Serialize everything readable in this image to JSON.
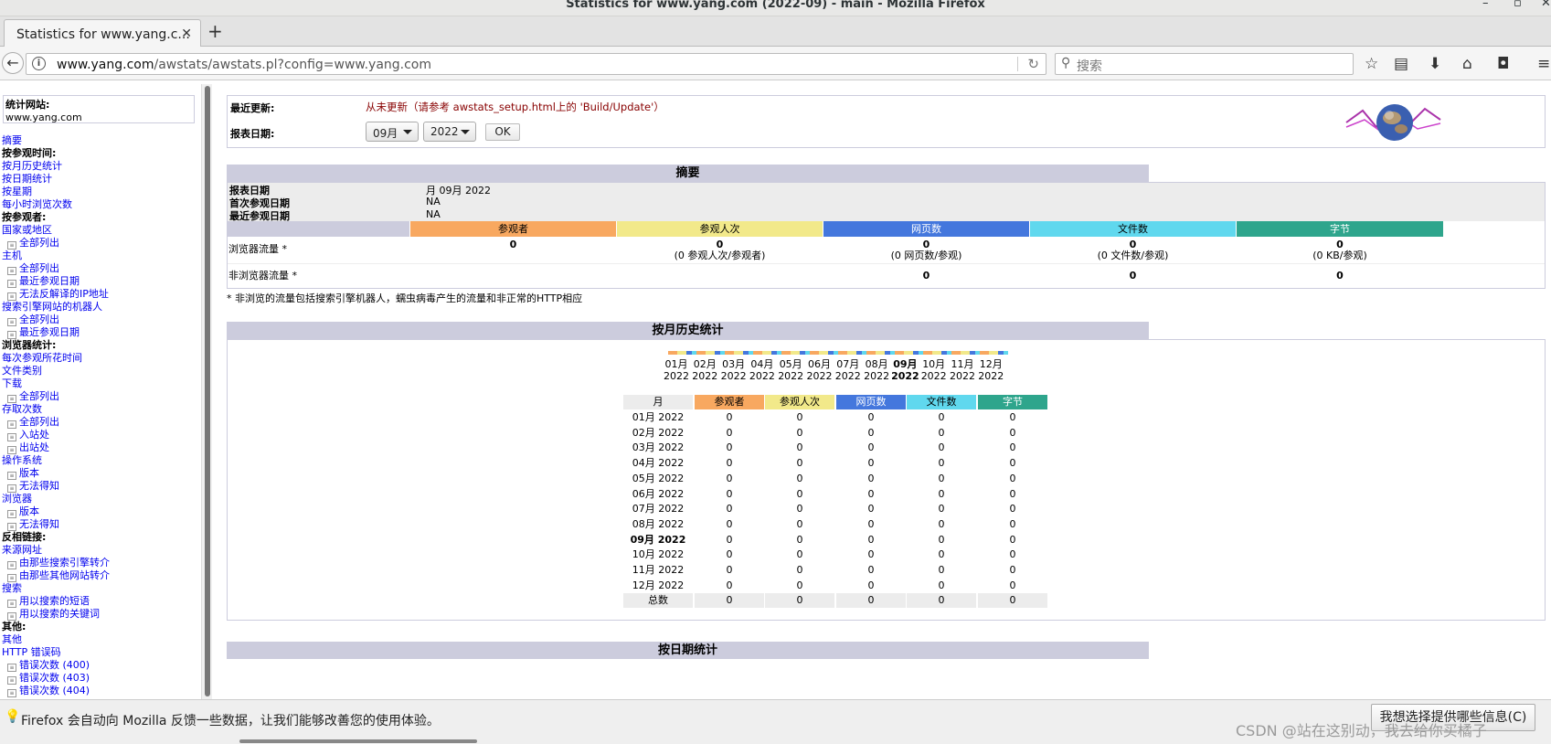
{
  "window": {
    "title": "Statistics for www.yang.com (2022-09) - main - Mozilla Firefox"
  },
  "tab": {
    "title": "Statistics for www.yang.c..."
  },
  "navbar": {
    "url_domain": "www.yang.com",
    "url_path": "/awstats/awstats.pl?config=www.yang.com",
    "search_placeholder": "搜索"
  },
  "sidebar": {
    "site_label": "统计网站:",
    "site_value": "www.yang.com",
    "items": [
      {
        "text": "摘要",
        "type": "lnk"
      },
      {
        "text": "按参观时间:",
        "type": "sec"
      },
      {
        "text": "按月历史统计",
        "type": "lnk"
      },
      {
        "text": "按日期统计",
        "type": "lnk"
      },
      {
        "text": "按星期",
        "type": "lnk"
      },
      {
        "text": "每小时浏览次数",
        "type": "lnk"
      },
      {
        "text": "按参观者:",
        "type": "sec"
      },
      {
        "text": "国家或地区",
        "type": "lnk"
      },
      {
        "text": "全部列出",
        "type": "sub"
      },
      {
        "text": "主机",
        "type": "lnk"
      },
      {
        "text": "全部列出",
        "type": "sub"
      },
      {
        "text": "最近参观日期",
        "type": "sub"
      },
      {
        "text": "无法反解译的IP地址",
        "type": "sub"
      },
      {
        "text": "搜索引擎网站的机器人",
        "type": "lnk"
      },
      {
        "text": "全部列出",
        "type": "sub"
      },
      {
        "text": "最近参观日期",
        "type": "sub"
      },
      {
        "text": "浏览器统计:",
        "type": "sec"
      },
      {
        "text": "每次参观所花时间",
        "type": "lnk"
      },
      {
        "text": "文件类别",
        "type": "lnk"
      },
      {
        "text": "下载",
        "type": "lnk"
      },
      {
        "text": "全部列出",
        "type": "sub"
      },
      {
        "text": "存取次数",
        "type": "lnk"
      },
      {
        "text": "全部列出",
        "type": "sub"
      },
      {
        "text": "入站处",
        "type": "sub"
      },
      {
        "text": "出站处",
        "type": "sub"
      },
      {
        "text": "操作系统",
        "type": "lnk"
      },
      {
        "text": "版本",
        "type": "sub"
      },
      {
        "text": "无法得知",
        "type": "sub"
      },
      {
        "text": "浏览器",
        "type": "lnk"
      },
      {
        "text": "版本",
        "type": "sub"
      },
      {
        "text": "无法得知",
        "type": "sub"
      },
      {
        "text": "反相链接:",
        "type": "sec"
      },
      {
        "text": "来源网址",
        "type": "lnk"
      },
      {
        "text": "由那些搜索引擎转介",
        "type": "sub"
      },
      {
        "text": "由那些其他网站转介",
        "type": "sub"
      },
      {
        "text": "搜索",
        "type": "lnk"
      },
      {
        "text": "用以搜索的短语",
        "type": "sub"
      },
      {
        "text": "用以搜索的关键词",
        "type": "sub"
      },
      {
        "text": "其他:",
        "type": "sec"
      },
      {
        "text": "其他",
        "type": "lnk"
      },
      {
        "text": "HTTP 错误码",
        "type": "lnk"
      },
      {
        "text": "错误次数 (400)",
        "type": "sub"
      },
      {
        "text": "错误次数 (403)",
        "type": "sub"
      },
      {
        "text": "错误次数 (404)",
        "type": "sub"
      }
    ]
  },
  "header": {
    "last_update_label": "最近更新:",
    "last_update_value": "从未更新（请参考 awstats_setup.html上的 'Build/Update'）",
    "report_date_label": "报表日期:",
    "month_select": "09月",
    "year_select": "2022",
    "ok_button": "OK"
  },
  "summary": {
    "title": "摘要",
    "rows": [
      {
        "k": "报表日期",
        "v": "月 09月 2022"
      },
      {
        "k": "首次参观日期",
        "v": "NA"
      },
      {
        "k": "最近参观日期",
        "v": "NA"
      }
    ],
    "cols": [
      "参观者",
      "参观人次",
      "网页数",
      "文件数",
      "字节"
    ],
    "browser_label": "浏览器流量 *",
    "browser_vals": [
      "0",
      "0",
      "0",
      "0",
      "0"
    ],
    "browser_subs": [
      "",
      "(0 参观人次/参观者)",
      "(0 网页数/参观)",
      "(0 文件数/参观)",
      "(0 KB/参观)"
    ],
    "nonbrowser_label": "非浏览器流量 *",
    "nonbrowser_vals": [
      "0",
      "0",
      "0"
    ],
    "footnote": "* 非浏览的流量包括搜索引擎机器人，蠕虫病毒产生的流量和非正常的HTTP相应"
  },
  "monthly": {
    "title": "按月历史统计",
    "months": [
      "01月",
      "02月",
      "03月",
      "04月",
      "05月",
      "06月",
      "07月",
      "08月",
      "09月",
      "10月",
      "11月",
      "12月"
    ],
    "year": "2022",
    "current_index": 8,
    "header": [
      "月",
      "参观者",
      "参观人次",
      "网页数",
      "文件数",
      "字节"
    ],
    "rows": [
      [
        "01月 2022",
        "0",
        "0",
        "0",
        "0",
        "0"
      ],
      [
        "02月 2022",
        "0",
        "0",
        "0",
        "0",
        "0"
      ],
      [
        "03月 2022",
        "0",
        "0",
        "0",
        "0",
        "0"
      ],
      [
        "04月 2022",
        "0",
        "0",
        "0",
        "0",
        "0"
      ],
      [
        "05月 2022",
        "0",
        "0",
        "0",
        "0",
        "0"
      ],
      [
        "06月 2022",
        "0",
        "0",
        "0",
        "0",
        "0"
      ],
      [
        "07月 2022",
        "0",
        "0",
        "0",
        "0",
        "0"
      ],
      [
        "08月 2022",
        "0",
        "0",
        "0",
        "0",
        "0"
      ],
      [
        "09月 2022",
        "0",
        "0",
        "0",
        "0",
        "0"
      ],
      [
        "10月 2022",
        "0",
        "0",
        "0",
        "0",
        "0"
      ],
      [
        "11月 2022",
        "0",
        "0",
        "0",
        "0",
        "0"
      ],
      [
        "12月 2022",
        "0",
        "0",
        "0",
        "0",
        "0"
      ]
    ],
    "total": [
      "总数",
      "0",
      "0",
      "0",
      "0",
      "0"
    ]
  },
  "daily": {
    "title": "按日期统计"
  },
  "colors": {
    "visitors": "#f8a860",
    "visits": "#f2e98a",
    "pages": "#4477dd",
    "hits": "#60d8ee",
    "bytes": "#2ea58c"
  },
  "notification": {
    "message": "Firefox 会自动向 Mozilla 反馈一些数据，让我们能够改善您的使用体验。",
    "button": "我想选择提供哪些信息(C)",
    "watermark": "CSDN @站在这别动，我去给你买橘子"
  }
}
